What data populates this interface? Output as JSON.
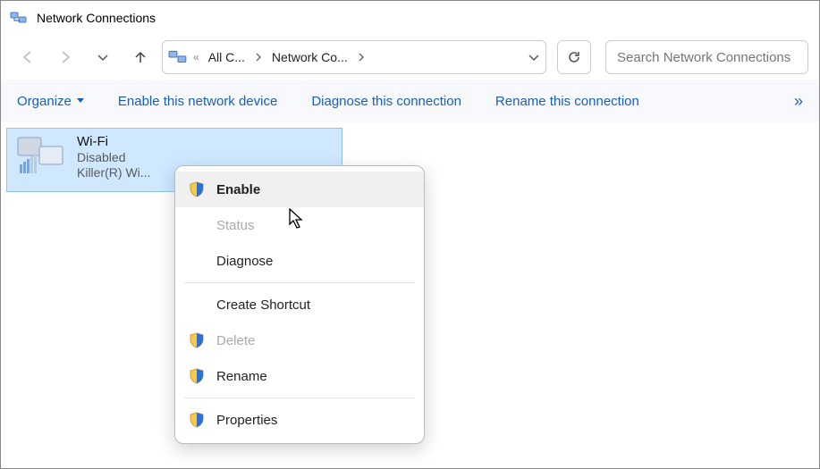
{
  "window": {
    "title": "Network Connections"
  },
  "address": {
    "crumb1": "All C...",
    "crumb2": "Network Co..."
  },
  "search": {
    "placeholder": "Search Network Connections"
  },
  "toolbar": {
    "organize": "Organize",
    "enable_device": "Enable this network device",
    "diagnose": "Diagnose this connection",
    "rename": "Rename this connection",
    "more": "»"
  },
  "adapter": {
    "name": "Wi-Fi",
    "status": "Disabled",
    "device": "Killer(R) Wi..."
  },
  "context_menu": {
    "enable": "Enable",
    "status": "Status",
    "diagnose": "Diagnose",
    "create_shortcut": "Create Shortcut",
    "delete": "Delete",
    "rename": "Rename",
    "properties": "Properties"
  }
}
